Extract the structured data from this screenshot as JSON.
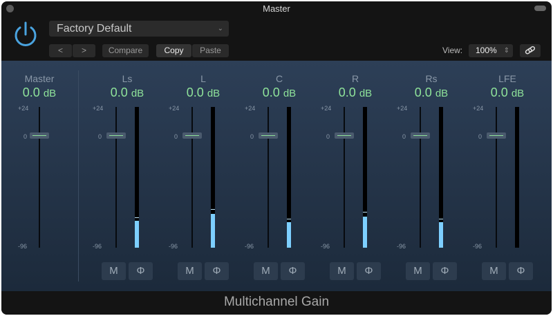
{
  "window": {
    "title": "Master"
  },
  "header": {
    "preset": "Factory Default",
    "prev": "<",
    "next": ">",
    "compare": "Compare",
    "copy": "Copy",
    "paste": "Paste",
    "view_label": "View:",
    "view_value": "100%"
  },
  "master": {
    "label": "Master",
    "value": "0.0",
    "unit": "dB",
    "max": "+24",
    "zero": "0",
    "min": "-96"
  },
  "channels": [
    {
      "label": "Ls",
      "value": "0.0",
      "unit": "dB",
      "max": "+24",
      "zero": "0",
      "min": "-96",
      "level": 0.19,
      "peak": 0.21,
      "mute": "M",
      "phase": "Φ"
    },
    {
      "label": "L",
      "value": "0.0",
      "unit": "dB",
      "max": "+24",
      "zero": "0",
      "min": "-96",
      "level": 0.24,
      "peak": 0.27,
      "mute": "M",
      "phase": "Φ"
    },
    {
      "label": "C",
      "value": "0.0",
      "unit": "dB",
      "max": "+24",
      "zero": "0",
      "min": "-96",
      "level": 0.18,
      "peak": 0.2,
      "mute": "M",
      "phase": "Φ"
    },
    {
      "label": "R",
      "value": "0.0",
      "unit": "dB",
      "max": "+24",
      "zero": "0",
      "min": "-96",
      "level": 0.22,
      "peak": 0.25,
      "mute": "M",
      "phase": "Φ"
    },
    {
      "label": "Rs",
      "value": "0.0",
      "unit": "dB",
      "max": "+24",
      "zero": "0",
      "min": "-96",
      "level": 0.18,
      "peak": 0.2,
      "mute": "M",
      "phase": "Φ"
    },
    {
      "label": "LFE",
      "value": "0.0",
      "unit": "dB",
      "max": "+24",
      "zero": "0",
      "min": "-96",
      "level": 0,
      "peak": 0,
      "mute": "M",
      "phase": "Φ"
    }
  ],
  "footer": {
    "title": "Multichannel Gain"
  }
}
